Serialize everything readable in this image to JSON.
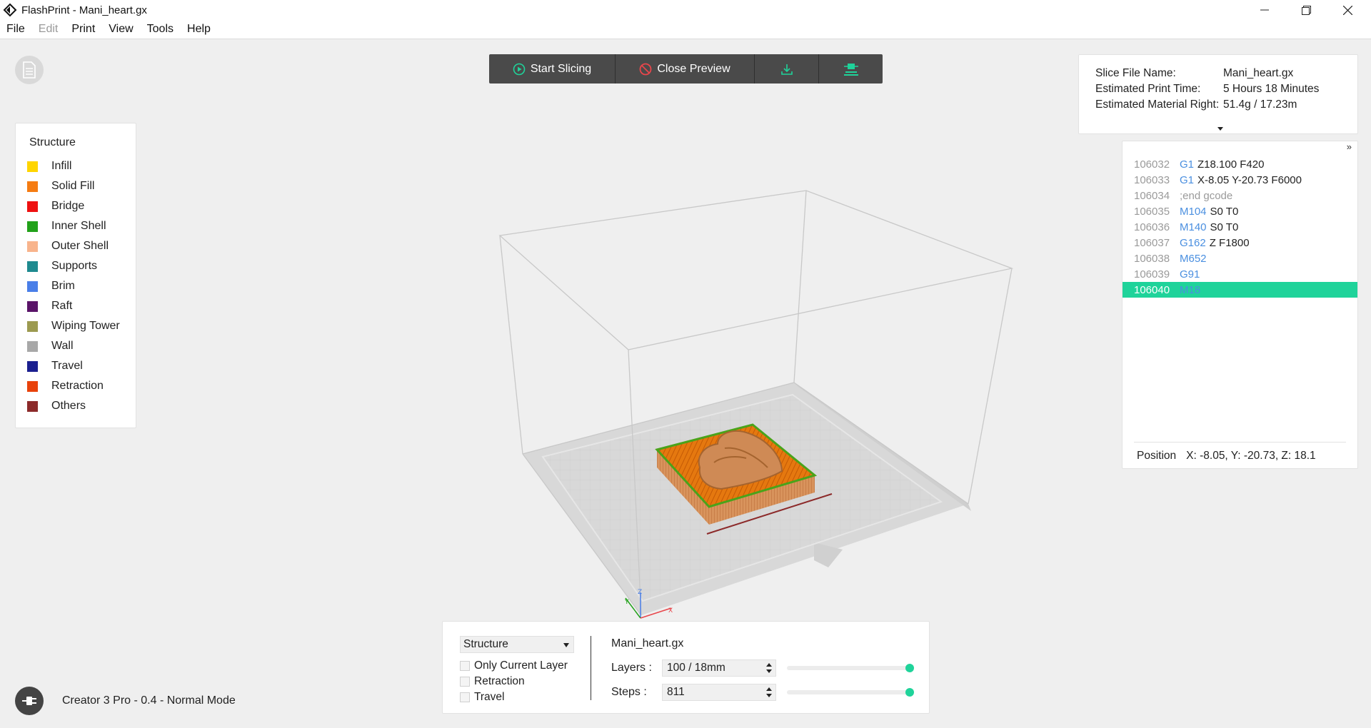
{
  "window": {
    "title": "FlashPrint - Mani_heart.gx"
  },
  "menu": [
    {
      "label": "File",
      "disabled": false
    },
    {
      "label": "Edit",
      "disabled": true
    },
    {
      "label": "Print",
      "disabled": false
    },
    {
      "label": "View",
      "disabled": false
    },
    {
      "label": "Tools",
      "disabled": false
    },
    {
      "label": "Help",
      "disabled": false
    }
  ],
  "toolbar": {
    "start_slicing": "Start Slicing",
    "close_preview": "Close Preview",
    "accent": "#1fd39a",
    "danger": "#e8464b"
  },
  "legend": {
    "title": "Structure",
    "items": [
      {
        "label": "Infill",
        "color": "#ffd500"
      },
      {
        "label": "Solid Fill",
        "color": "#f57c12"
      },
      {
        "label": "Bridge",
        "color": "#ee1111"
      },
      {
        "label": "Inner Shell",
        "color": "#22a11a"
      },
      {
        "label": "Outer Shell",
        "color": "#f8b48c"
      },
      {
        "label": "Supports",
        "color": "#1f8a8f"
      },
      {
        "label": "Brim",
        "color": "#4a7fe8"
      },
      {
        "label": "Raft",
        "color": "#5a1468"
      },
      {
        "label": "Wiping Tower",
        "color": "#9c9a50"
      },
      {
        "label": "Wall",
        "color": "#a8a8a8"
      },
      {
        "label": "Travel",
        "color": "#1b1f8f"
      },
      {
        "label": "Retraction",
        "color": "#e8420c"
      },
      {
        "label": "Others",
        "color": "#8c2a2a"
      }
    ]
  },
  "info": {
    "file_label": "Slice File Name:",
    "file_value": "Mani_heart.gx",
    "time_label": "Estimated Print Time:",
    "time_value": "5 Hours 18 Minutes",
    "material_label": "Estimated Material Right:",
    "material_value": "51.4g / 17.23m"
  },
  "gcode": {
    "expand_label": "»",
    "lines": [
      {
        "ln": "106032",
        "cmd": "G1",
        "args": "Z18.100 F420"
      },
      {
        "ln": "106033",
        "cmd": "G1",
        "args": "X-8.05 Y-20.73 F6000"
      },
      {
        "ln": "106034",
        "cmd": "",
        "args": "",
        "comment": ";end gcode"
      },
      {
        "ln": "106035",
        "cmd": "M104",
        "args": "S0 T0"
      },
      {
        "ln": "106036",
        "cmd": "M140",
        "args": "S0 T0"
      },
      {
        "ln": "106037",
        "cmd": "G162",
        "args": "Z F1800"
      },
      {
        "ln": "106038",
        "cmd": "M652",
        "args": ""
      },
      {
        "ln": "106039",
        "cmd": "G91",
        "args": ""
      },
      {
        "ln": "106040",
        "cmd": "M18",
        "args": "",
        "active": true
      }
    ],
    "position_label": "Position",
    "position_value": "X: -8.05, Y: -20.73, Z: 18.1"
  },
  "controls": {
    "mode_select": "Structure",
    "only_current_layer": "Only Current Layer",
    "retraction": "Retraction",
    "travel": "Travel",
    "file_name": "Mani_heart.gx",
    "layers_label": "Layers :",
    "layers_value": "100 / 18mm",
    "layers_slider": 1.0,
    "steps_label": "Steps :",
    "steps_value": "811",
    "steps_slider": 1.0
  },
  "status": {
    "machine": "Creator 3 Pro - 0.4 - Normal Mode"
  }
}
